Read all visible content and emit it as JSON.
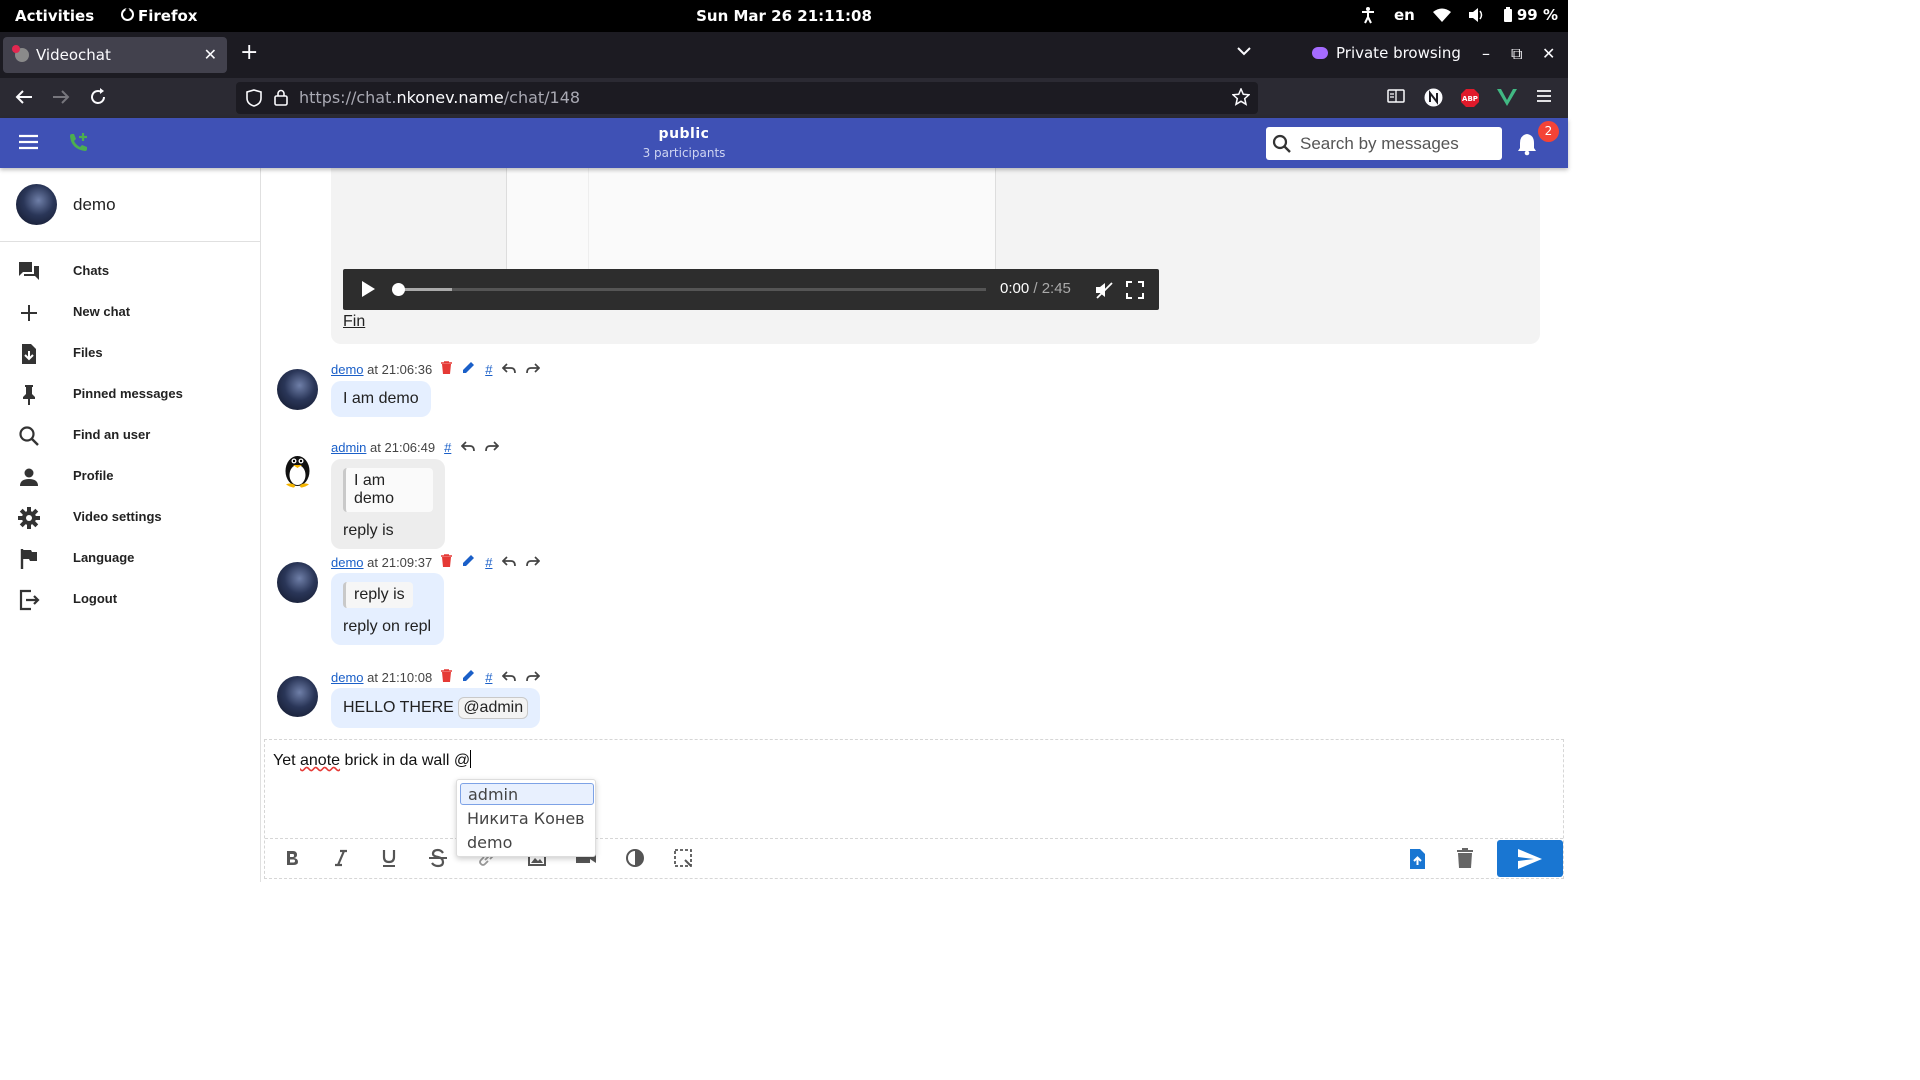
{
  "os": {
    "activities": "Activities",
    "app_name": "Firefox",
    "clock": "Sun Mar 26  21:11:08",
    "lang": "en",
    "battery": "99 %"
  },
  "browser": {
    "tab_title": "Videochat",
    "private_label": "Private browsing",
    "url_prefix": "https://chat.",
    "url_domain": "nkonev.name",
    "url_path": "/chat/148"
  },
  "header": {
    "title": "public",
    "subtitle": "3 participants",
    "search_placeholder": "Search by messages",
    "notifications_count": "2"
  },
  "sidebar": {
    "user_name": "demo",
    "items": [
      {
        "label": "Chats",
        "icon": "forum-icon"
      },
      {
        "label": "New chat",
        "icon": "plus-icon"
      },
      {
        "label": "Files",
        "icon": "file-download-icon"
      },
      {
        "label": "Pinned messages",
        "icon": "pin-icon"
      },
      {
        "label": "Find an user",
        "icon": "search-icon"
      },
      {
        "label": "Profile",
        "icon": "person-icon"
      },
      {
        "label": "Video settings",
        "icon": "gear-icon"
      },
      {
        "label": "Language",
        "icon": "flag-icon"
      },
      {
        "label": "Logout",
        "icon": "logout-icon"
      }
    ]
  },
  "video": {
    "current_time": "0:00",
    "duration": "/ 2:45",
    "caption_link": "Fin"
  },
  "messages": [
    {
      "user": "demo",
      "time": "at 21:06:36",
      "text": "I am demo"
    },
    {
      "user": "admin",
      "time": "at 21:06:49",
      "quote": "I am demo",
      "text": "reply is"
    },
    {
      "user": "demo",
      "time": "at 21:09:37",
      "quote": "reply is",
      "text": "reply on repl"
    },
    {
      "user": "demo",
      "time": "at 21:10:08",
      "text": "HELLO THERE",
      "mention": "@admin"
    }
  ],
  "editor": {
    "text_before": "Yet ",
    "misspelled": "anote",
    "text_after": " brick in da wall @"
  },
  "suggestions": [
    "admin",
    "Никита Конев",
    "demo"
  ],
  "colors": {
    "header": "#3f51b5",
    "own_bubble": "#e5efff",
    "other_bubble": "#ededed",
    "link": "#1a5fc8",
    "delete": "#e53935",
    "send": "#1976d2"
  }
}
